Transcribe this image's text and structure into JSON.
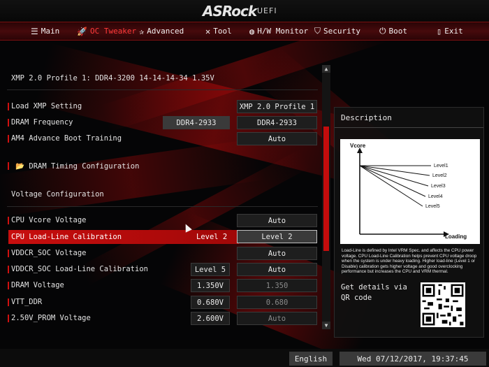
{
  "header": {
    "brand": "ASRock",
    "firmware": "UEFI"
  },
  "nav": {
    "tabs": [
      {
        "label": "Main",
        "icon": "list-icon"
      },
      {
        "label": "OC Tweaker",
        "icon": "rocket-icon"
      },
      {
        "label": "Advanced",
        "icon": "star-icon"
      },
      {
        "label": "Tool",
        "icon": "tools-icon"
      },
      {
        "label": "H/W Monitor",
        "icon": "monitor-icon"
      },
      {
        "label": "Security",
        "icon": "shield-icon"
      },
      {
        "label": "Boot",
        "icon": "power-icon"
      },
      {
        "label": "Exit",
        "icon": "exit-door-icon"
      }
    ],
    "active": "OC Tweaker"
  },
  "settings": {
    "xmp_info": "XMP 2.0 Profile 1: DDR4-3200 14-14-14-34 1.35V",
    "load_xmp": {
      "label": "Load XMP Setting",
      "value": "XMP 2.0 Profile 1"
    },
    "dram_freq": {
      "label": "DRAM Frequency",
      "current": "DDR4-2933",
      "value": "DDR4-2933"
    },
    "am4_boot": {
      "label": "AM4 Advance Boot Training",
      "value": "Auto"
    },
    "dram_timing": {
      "label": "DRAM Timing Configuration",
      "icon": "folder-icon"
    },
    "voltage_header": "Voltage Configuration",
    "cpu_vcore": {
      "label": "CPU Vcore Voltage",
      "value": "Auto"
    },
    "llc": {
      "label": "CPU Load-Line Calibration",
      "current": "Level 2",
      "value": "Level 2"
    },
    "vddcr_soc": {
      "label": "VDDCR_SOC Voltage",
      "value": "Auto"
    },
    "vddcr_soc_llc": {
      "label": "VDDCR_SOC Load-Line Calibration",
      "current": "Level 5",
      "value": "Auto"
    },
    "dram_voltage": {
      "label": "DRAM Voltage",
      "current": "1.350V",
      "value": "1.350"
    },
    "vtt_ddr": {
      "label": "VTT_DDR",
      "current": "0.680V",
      "value": "0.680"
    },
    "prom": {
      "label": "2.50V_PROM Voltage",
      "current": "2.600V",
      "value": "Auto"
    }
  },
  "description": {
    "title": "Description",
    "graph": {
      "y_label": "Vcore",
      "x_label": "Loading",
      "levels": [
        "Level1",
        "Level2",
        "Level3",
        "Level4",
        "Level5"
      ]
    },
    "text": "Load-Line is defined by Intel VRM Spec. and affects the CPU power voltage. CPU Load-Line Calibration helps prevent CPU voltage droop when the system is under heavy loading. Higher load-line (Level 1 or Disable) calibration gets higher voltage and good overclocking performance but increases the CPU and VRM thermal.",
    "qr_label": "Get details via QR code"
  },
  "footer": {
    "language": "English",
    "datetime": "Wed 07/12/2017, 19:37:45"
  },
  "colors": {
    "accent": "#c80e0e",
    "active_tab": "#ff3a3a",
    "background": "#050506"
  }
}
